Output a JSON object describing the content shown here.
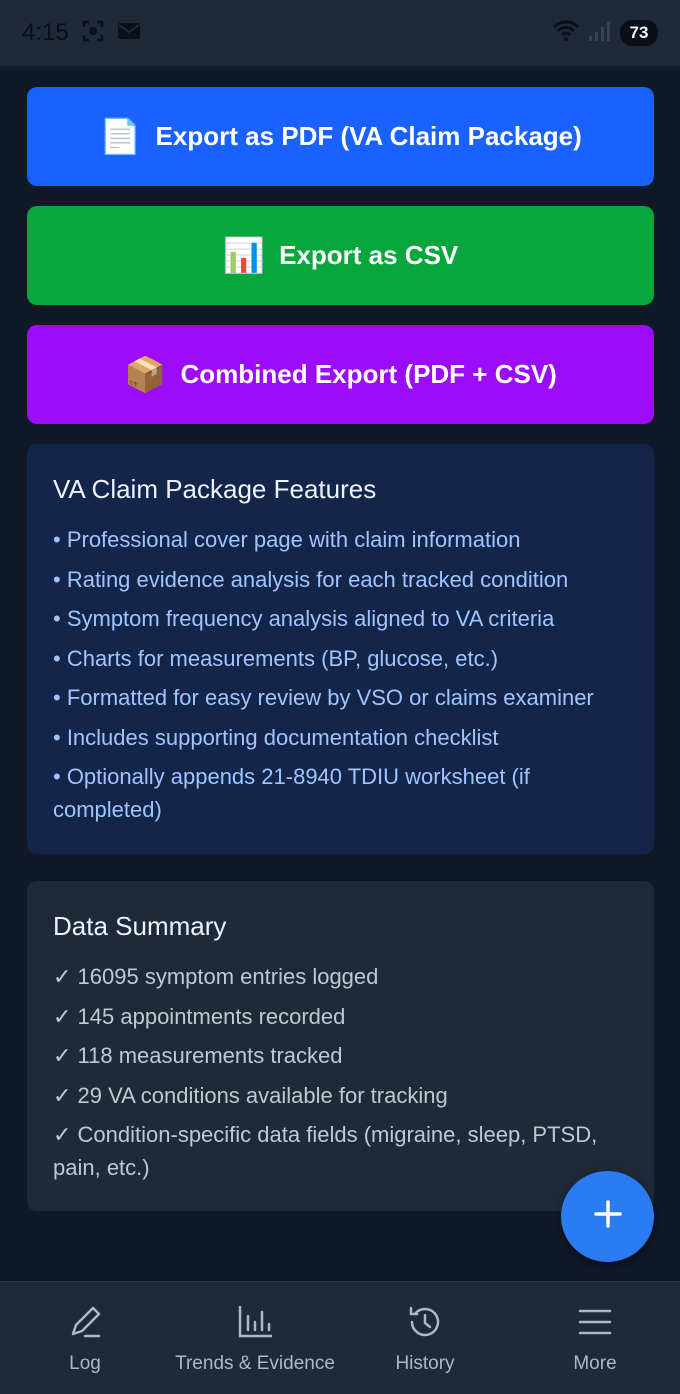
{
  "status_bar": {
    "time": "4:15",
    "battery": "73"
  },
  "buttons": {
    "pdf": {
      "icon": "📄",
      "label": "Export as PDF (VA Claim Package)"
    },
    "csv": {
      "icon": "📊",
      "label": "Export as CSV"
    },
    "combined": {
      "icon": "📦",
      "label": "Combined Export (PDF + CSV)"
    }
  },
  "features": {
    "title": "VA Claim Package Features",
    "items": [
      "• Professional cover page with claim information",
      "• Rating evidence analysis for each tracked condition",
      "• Symptom frequency analysis aligned to VA criteria",
      "• Charts for measurements (BP, glucose, etc.)",
      "• Formatted for easy review by VSO or claims examiner",
      "• Includes supporting documentation checklist",
      "• Optionally appends 21-8940 TDIU worksheet (if completed)"
    ]
  },
  "summary": {
    "title": "Data Summary",
    "items": [
      "✓ 16095 symptom entries logged",
      "✓ 145 appointments recorded",
      "✓ 118 measurements tracked",
      "✓ 29 VA conditions available for tracking",
      "✓ Condition-specific data fields (migraine, sleep, PTSD, pain, etc.)"
    ]
  },
  "nav": {
    "items": [
      {
        "label": "Log",
        "icon": "pencil-icon"
      },
      {
        "label": "Trends & Evidence",
        "icon": "bar-chart-icon"
      },
      {
        "label": "History",
        "icon": "history-icon"
      },
      {
        "label": "More",
        "icon": "menu-icon"
      }
    ]
  }
}
